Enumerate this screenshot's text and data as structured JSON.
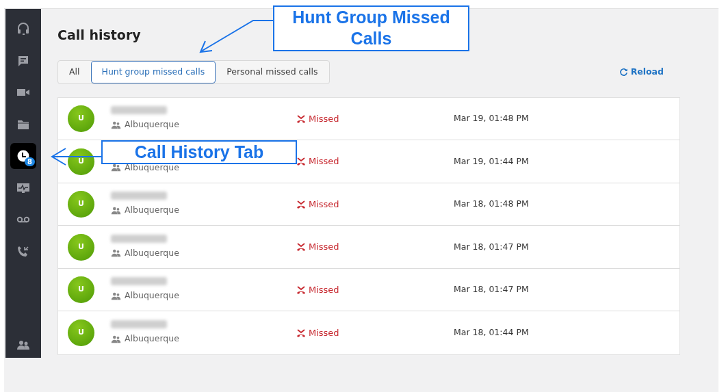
{
  "sidebar": {
    "items": [
      {
        "selected": false
      },
      {
        "selected": false
      },
      {
        "selected": false
      },
      {
        "selected": false
      },
      {
        "selected": true,
        "badge": "8"
      },
      {
        "selected": false
      },
      {
        "selected": false
      },
      {
        "selected": false
      }
    ],
    "bottom_items": [
      {
        "selected": false
      }
    ]
  },
  "page_title": "Call history",
  "tabs": [
    {
      "label": "All",
      "selected": false
    },
    {
      "label": "Hunt group missed calls",
      "selected": true
    },
    {
      "label": "Personal missed calls",
      "selected": false
    }
  ],
  "reload_button": "Reload",
  "calls": [
    {
      "avatar": "U",
      "number_hidden": true,
      "location": "Albuquerque",
      "status": "Missed",
      "time": "Mar 19, 01:48 PM"
    },
    {
      "avatar": "U",
      "location": "Albuquerque",
      "status": "Missed",
      "time": "Mar 19, 01:44 PM"
    },
    {
      "avatar": "U",
      "number_hidden": true,
      "location": "Albuquerque",
      "status": "Missed",
      "time": "Mar 18, 01:48 PM"
    },
    {
      "avatar": "U",
      "number_hidden": true,
      "location": "Albuquerque",
      "status": "Missed",
      "time": "Mar 18, 01:47 PM"
    },
    {
      "avatar": "U",
      "number_hidden": true,
      "location": "Albuquerque",
      "status": "Missed",
      "time": "Mar 18, 01:47 PM"
    },
    {
      "avatar": "U",
      "number_hidden": true,
      "location": "Albuquerque",
      "status": "Missed",
      "time": "Mar 18, 01:44 PM"
    }
  ],
  "annotations": [
    {
      "text": "Hunt Group Missed Calls"
    },
    {
      "text": "Call History Tab"
    }
  ]
}
